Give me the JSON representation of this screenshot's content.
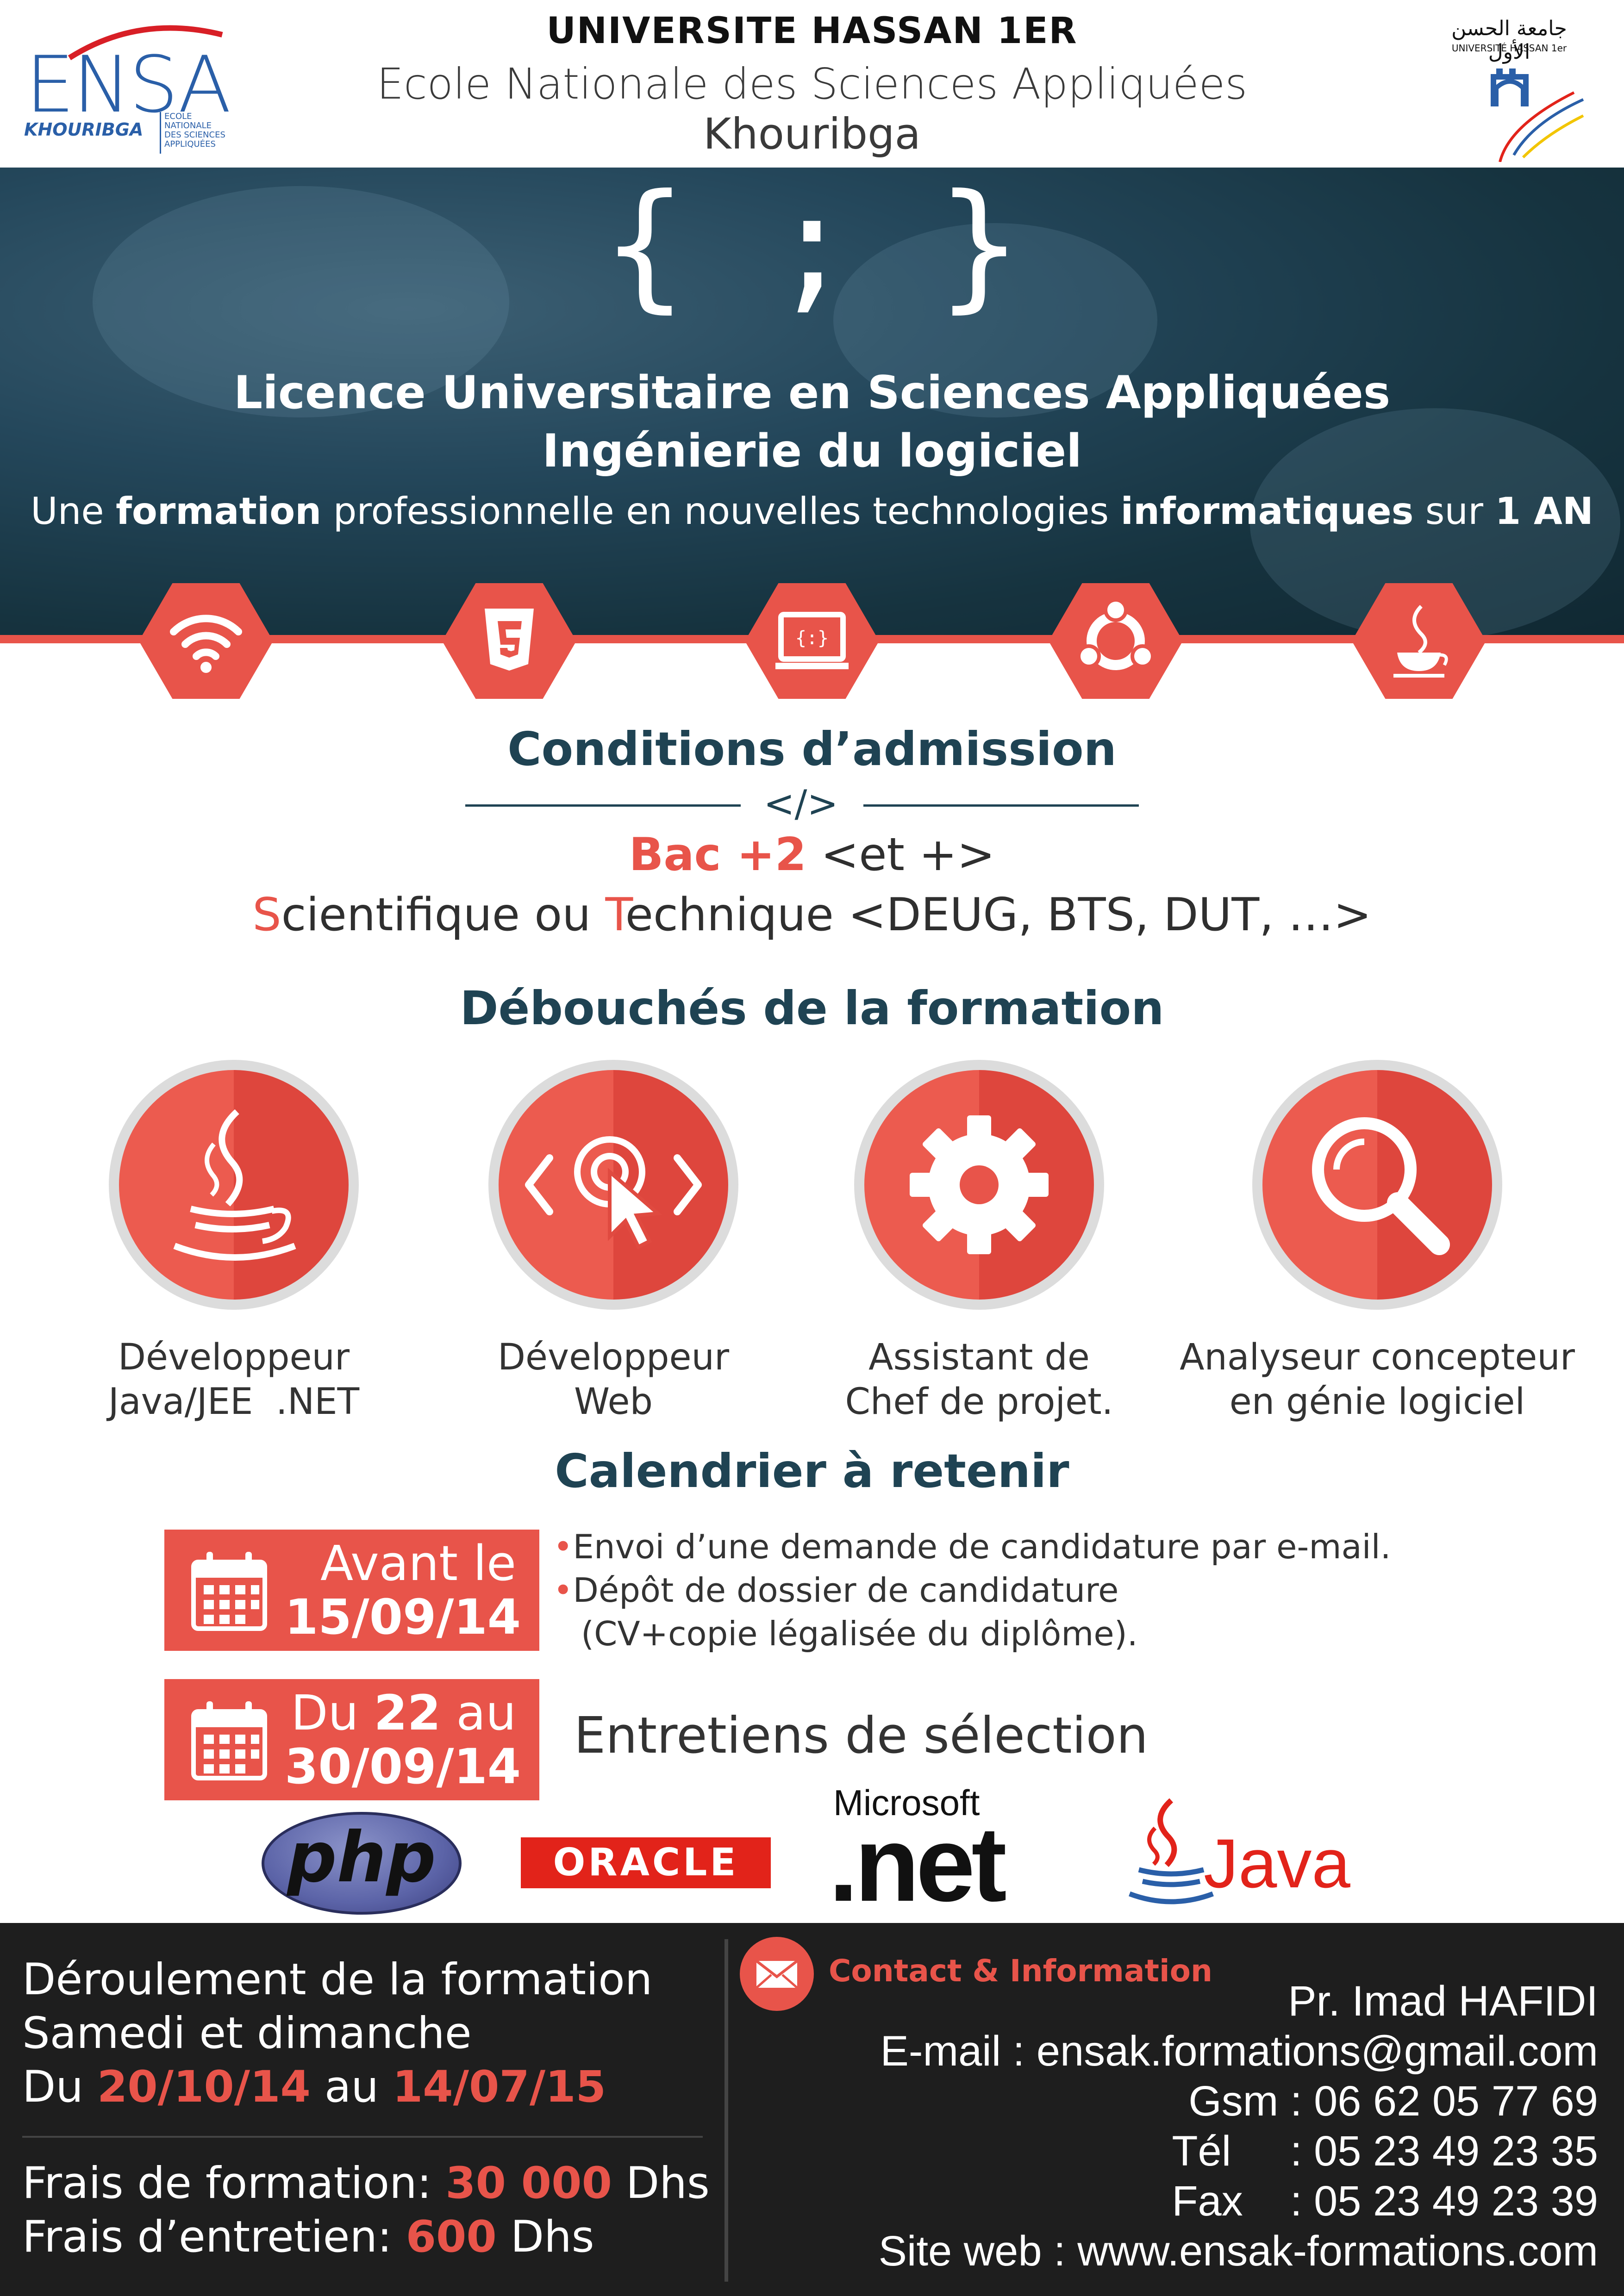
{
  "header": {
    "university": "UNIVERSITE HASSAN 1ER",
    "school": "Ecole Nationale des Sciences Appliquées",
    "city": "Khouribga",
    "ensa_logo": {
      "big": "ENSA",
      "small": "KHOURIBGA",
      "sub": [
        "ECOLE",
        "NATIONALE",
        "DES SCIENCES",
        "APPLIQUÉES"
      ]
    },
    "uh1_logo": {
      "arabic": "جامعة الحسن الأول",
      "latin": "UNIVERSITÉ HASSAN 1er"
    }
  },
  "banner": {
    "braces": "{ ; }",
    "title": "Licence Universitaire en Sciences Appliquées",
    "subtitle": "Ingénierie du logiciel",
    "tagline": {
      "p1": "Une ",
      "b1": "formation",
      "p2": " professionnelle en nouvelles technologies ",
      "b2": "informatiques",
      "p3": " sur ",
      "b3": "1 AN"
    },
    "icons": [
      "wifi-icon",
      "html5-icon",
      "code-laptop-icon",
      "ubuntu-icon",
      "java-cup-icon"
    ],
    "accent": "#e8544a"
  },
  "admission": {
    "title": "Conditions d’admission",
    "divider": "</>",
    "line1_red": "Bac +2",
    "line1_rest": " <et +>",
    "line2": {
      "s": "S",
      "a": "cientifique ou ",
      "t": "T",
      "b": "echnique <DEUG, BTS, DUT, …>"
    }
  },
  "debouches": {
    "title": "Débouchés de la formation",
    "jobs": [
      {
        "icon": "java-cup-icon",
        "line1": "Développeur",
        "line2": "Java/JEE  .NET"
      },
      {
        "icon": "web-cursor-icon",
        "line1": "Développeur",
        "line2": "Web"
      },
      {
        "icon": "gear-icon",
        "line1": "Assistant de",
        "line2": "Chef de projet."
      },
      {
        "icon": "magnifier-icon",
        "line1": "Analyseur concepteur",
        "line2": "en génie logiciel"
      }
    ]
  },
  "calendar": {
    "title": "Calendrier à retenir",
    "box1": {
      "line1": "Avant le",
      "line2": "15/09/14"
    },
    "items1": [
      "Envoi d’une demande de candidature par e-mail.",
      "Dépôt de dossier de candidature",
      "(CV+copie légalisée du diplôme)."
    ],
    "box2": {
      "pre": "Du ",
      "day": "22",
      "post": " au",
      "line2": "30/09/14"
    },
    "item2": "Entretiens de sélection"
  },
  "logos": {
    "php": "php",
    "oracle": "ORACLE",
    "microsoft": "Microsoft",
    "net": ".net",
    "java": "Java"
  },
  "footer": {
    "l1": "Déroulement de la formation",
    "l2": "Samedi et dimanche",
    "l3": {
      "pre": "Du ",
      "from": "20/10/14",
      "mid": " au ",
      "to": "14/07/15"
    },
    "fee1": {
      "label": "Frais de formation: ",
      "amount": "30 000",
      "unit": " Dhs"
    },
    "fee2": {
      "label": "Frais d’entretien: ",
      "amount": "600",
      "unit": " Dhs"
    },
    "contact_title": "Contact & Information",
    "name": "Pr. Imad HAFIDI",
    "email": "E-mail : ensak.formations@gmail.com",
    "gsm": "Gsm : 06 62 05 77 69",
    "tel": "Tél     : 05 23 49 23 35",
    "fax": "Fax    : 05 23 49 23 39",
    "site": "Site web : www.ensak-formations.com"
  }
}
